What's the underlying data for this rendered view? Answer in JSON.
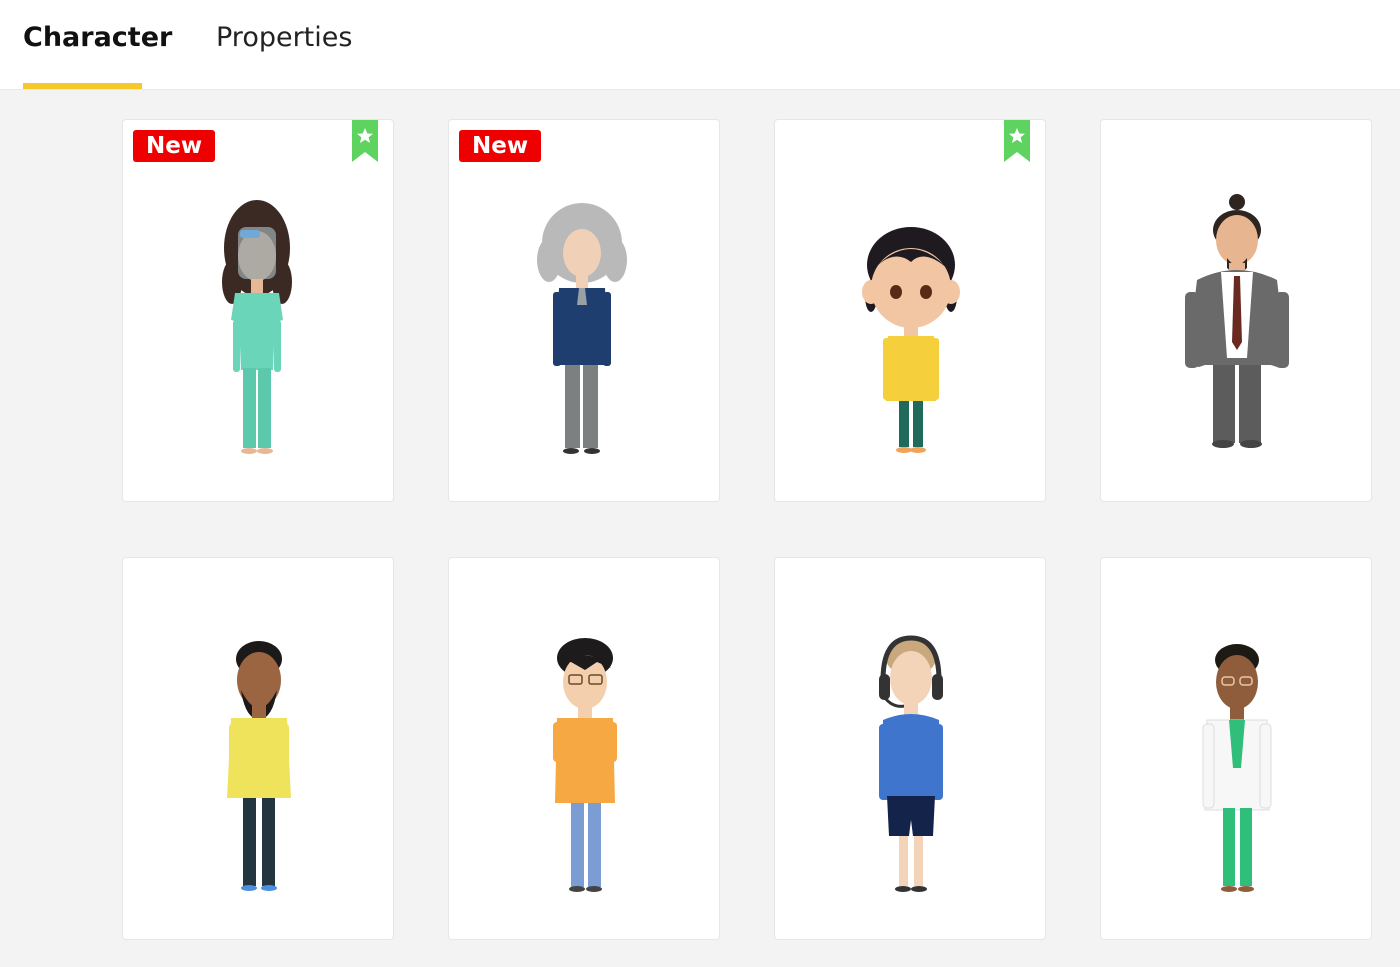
{
  "tabs": [
    {
      "label": "Character",
      "active": true
    },
    {
      "label": "Properties",
      "active": false
    }
  ],
  "colors": {
    "accent_underline": "#f7c82a",
    "badge_new": "#ef0000",
    "bookmark": "#5fd35f"
  },
  "cards": [
    {
      "badge": "New",
      "bookmark": "star-bookmark-icon"
    },
    {
      "badge": "New"
    },
    {
      "bookmark": "star-bookmark-icon"
    },
    {},
    {},
    {},
    {},
    {}
  ]
}
